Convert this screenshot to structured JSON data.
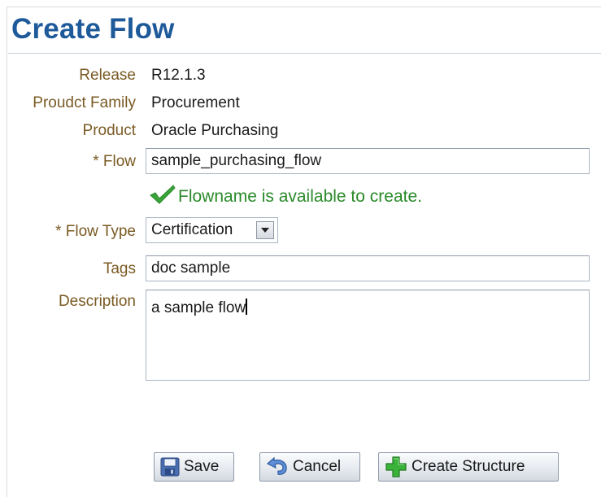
{
  "page": {
    "title": "Create Flow"
  },
  "form": {
    "release": {
      "label": "Release",
      "value": "R12.1.3"
    },
    "product_family": {
      "label": "Proudct Family",
      "value": "Procurement"
    },
    "product": {
      "label": "Product",
      "value": "Oracle Purchasing"
    },
    "flow": {
      "required_mark": "*",
      "label": "Flow",
      "value": "sample_purchasing_flow"
    },
    "availability_message": "Flowname is available to create.",
    "flow_type": {
      "required_mark": "*",
      "label": "Flow Type",
      "value": "Certification"
    },
    "tags": {
      "label": "Tags",
      "value": "doc sample"
    },
    "description": {
      "label": "Description",
      "value": "a sample flow"
    }
  },
  "buttons": {
    "save": {
      "label": "Save",
      "icon": "floppy-disk-icon"
    },
    "cancel": {
      "label": "Cancel",
      "icon": "undo-icon"
    },
    "create_structure": {
      "label": "Create Structure",
      "icon": "green-plus-icon"
    }
  },
  "colors": {
    "title": "#1e5a9a",
    "label": "#7a5a23",
    "success": "#2a8a2a"
  }
}
